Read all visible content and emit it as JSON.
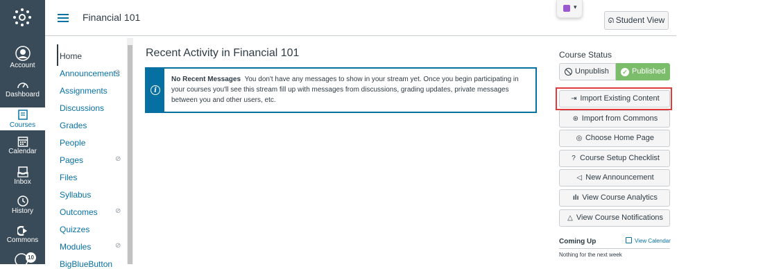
{
  "global_nav": {
    "items": [
      {
        "label": "Account",
        "icon": "account-icon"
      },
      {
        "label": "Dashboard",
        "icon": "dashboard-icon"
      },
      {
        "label": "Courses",
        "icon": "courses-icon"
      },
      {
        "label": "Calendar",
        "icon": "calendar-icon"
      },
      {
        "label": "Inbox",
        "icon": "inbox-icon"
      },
      {
        "label": "History",
        "icon": "history-icon"
      },
      {
        "label": "Commons",
        "icon": "commons-icon"
      }
    ],
    "help_badge": "10",
    "bg_color": "#394b58"
  },
  "header": {
    "breadcrumb": "Financial 101",
    "student_view_label": "Student View"
  },
  "course_nav": {
    "items": [
      {
        "label": "Home"
      },
      {
        "label": "Announcements",
        "hidden": true
      },
      {
        "label": "Assignments"
      },
      {
        "label": "Discussions"
      },
      {
        "label": "Grades"
      },
      {
        "label": "People"
      },
      {
        "label": "Pages",
        "hidden": true
      },
      {
        "label": "Files"
      },
      {
        "label": "Syllabus"
      },
      {
        "label": "Outcomes",
        "hidden": true
      },
      {
        "label": "Quizzes"
      },
      {
        "label": "Modules",
        "hidden": true
      },
      {
        "label": "BigBlueButton"
      }
    ],
    "link_color": "#0770a3"
  },
  "main": {
    "title": "Recent Activity in Financial 101",
    "alert_title": "No Recent Messages",
    "alert_body": "You don't have any messages to show in your stream yet. Once you begin participating in your courses you'll see this stream fill up with messages from discussions, grading updates, private messages between you and other users, etc."
  },
  "sidebar": {
    "status_heading": "Course Status",
    "unpublish_label": "Unpublish",
    "published_label": "Published",
    "buttons": [
      {
        "label": "Import Existing Content",
        "icon": "import-icon"
      },
      {
        "label": "Import from Commons",
        "icon": "commons-icon"
      },
      {
        "label": "Choose Home Page",
        "icon": "home-page-icon"
      },
      {
        "label": "Course Setup Checklist",
        "icon": "checklist-icon"
      },
      {
        "label": "New Announcement",
        "icon": "announcement-icon"
      },
      {
        "label": "View Course Analytics",
        "icon": "analytics-icon"
      },
      {
        "label": "View Course Notifications",
        "icon": "bell-icon"
      }
    ],
    "coming_up_heading": "Coming Up",
    "view_calendar_label": "View Calendar",
    "coming_up_empty": "Nothing for the next week",
    "published_color": "#7cbd6b",
    "highlight_color": "#e03b3b"
  }
}
